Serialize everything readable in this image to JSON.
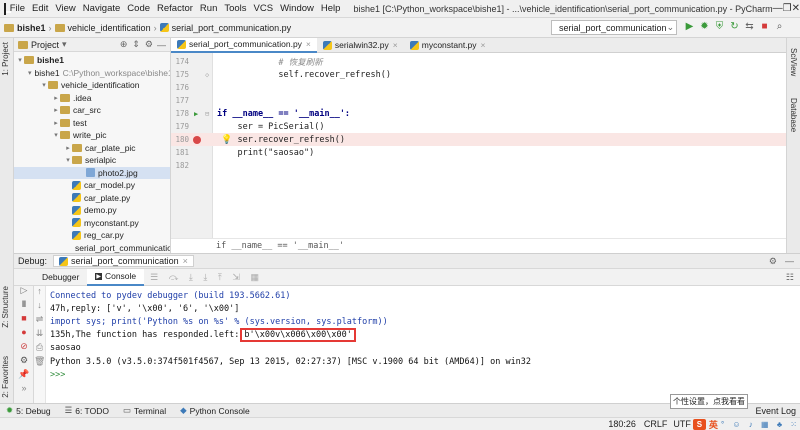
{
  "window": {
    "title": "bishe1 [C:\\Python_workspace\\bishe1] - ...\\vehicle_identification\\serial_port_communication.py - PyCharm",
    "controls": [
      "—",
      "❐",
      "✕"
    ]
  },
  "menu": [
    "File",
    "Edit",
    "View",
    "Navigate",
    "Code",
    "Refactor",
    "Run",
    "Tools",
    "VCS",
    "Window",
    "Help"
  ],
  "breadcrumb": [
    "bishe1",
    "vehicle_identification",
    "serial_port_communication.py"
  ],
  "run_config": "serial_port_communication",
  "left_stripe": {
    "project": "1: Project",
    "structure": "Z: Structure",
    "favorites": "2: Favorites"
  },
  "right_stripe": {
    "sciview": "SciView",
    "database": "Database"
  },
  "project_panel": {
    "title": "Project",
    "root": "bishe1",
    "items": [
      {
        "label": "bishe1",
        "path": "C:\\Python_workspace\\bishe1",
        "type": "folder",
        "arrow": "▾"
      },
      {
        "label": "vehicle_identification",
        "type": "folder",
        "arrow": "▾"
      },
      {
        "label": ".idea",
        "type": "folder",
        "arrow": "▸"
      },
      {
        "label": "car_src",
        "type": "folder",
        "arrow": "▸"
      },
      {
        "label": "test",
        "type": "folder",
        "arrow": "▸"
      },
      {
        "label": "write_pic",
        "type": "folder",
        "arrow": "▾"
      },
      {
        "label": "car_plate_pic",
        "type": "folder",
        "arrow": "▸"
      },
      {
        "label": "serialpic",
        "type": "folder",
        "arrow": "▾"
      },
      {
        "label": "photo2.jpg",
        "type": "image",
        "arrow": ""
      },
      {
        "label": "car_model.py",
        "type": "py",
        "arrow": ""
      },
      {
        "label": "car_plate.py",
        "type": "py",
        "arrow": ""
      },
      {
        "label": "demo.py",
        "type": "py",
        "arrow": ""
      },
      {
        "label": "myconstant.py",
        "type": "py",
        "arrow": ""
      },
      {
        "label": "reg_car.py",
        "type": "py",
        "arrow": ""
      },
      {
        "label": "serial_port_communication",
        "type": "py",
        "arrow": ""
      }
    ]
  },
  "editor": {
    "tabs": [
      "serial_port_communication.py",
      "serialwin32.py",
      "myconstant.py"
    ],
    "lines": [
      {
        "num": "174",
        "code": "            # 恢复刷新"
      },
      {
        "num": "175",
        "code": "            self.recover_refresh()"
      },
      {
        "num": "176",
        "code": ""
      },
      {
        "num": "177",
        "code": ""
      },
      {
        "num": "178",
        "code": "if __name__ == '__main__':"
      },
      {
        "num": "179",
        "code": "    ser = PicSerial()"
      },
      {
        "num": "180",
        "code": "    ser.recover_refresh()"
      },
      {
        "num": "181",
        "code": "    print(\"saosao\")"
      },
      {
        "num": "182",
        "code": ""
      }
    ],
    "breadcrumb": "if __name__ == '__main__'"
  },
  "debug": {
    "label": "Debug:",
    "config": "serial_port_communication",
    "tabs": [
      "Debugger",
      "Console"
    ],
    "console": [
      {
        "text": "Connected to pydev debugger (build 193.5662.61)",
        "style": "blue"
      },
      {
        "text": "47h,reply: ['v', '\\x00', '6', '\\x00']",
        "style": "black"
      },
      {
        "text": "import sys; print('Python %s on %s' % (sys.version, sys.platform))",
        "style": "blue"
      },
      {
        "text": "135h,The function has responded.left:",
        "highlight": "b'\\x00v\\x006\\x00\\x00'",
        "style": "black"
      },
      {
        "text": "saosao",
        "style": "black"
      },
      {
        "text": "Python 3.5.0 (v3.5.0:374f501f4567, Sep 13 2015, 02:27:37) [MSC v.1900 64 bit (AMD64)] on win32",
        "style": "black"
      },
      {
        "text": ">>>",
        "style": "green"
      }
    ]
  },
  "bottom_tabs": [
    "5: Debug",
    "6: TODO",
    "Terminal",
    "Python Console"
  ],
  "event_log": "Event Log",
  "tooltip": "个性设置，点我看看",
  "status": {
    "position": "180:26",
    "line_sep": "CRLF",
    "encoding": "UTF",
    "ime": "英"
  }
}
